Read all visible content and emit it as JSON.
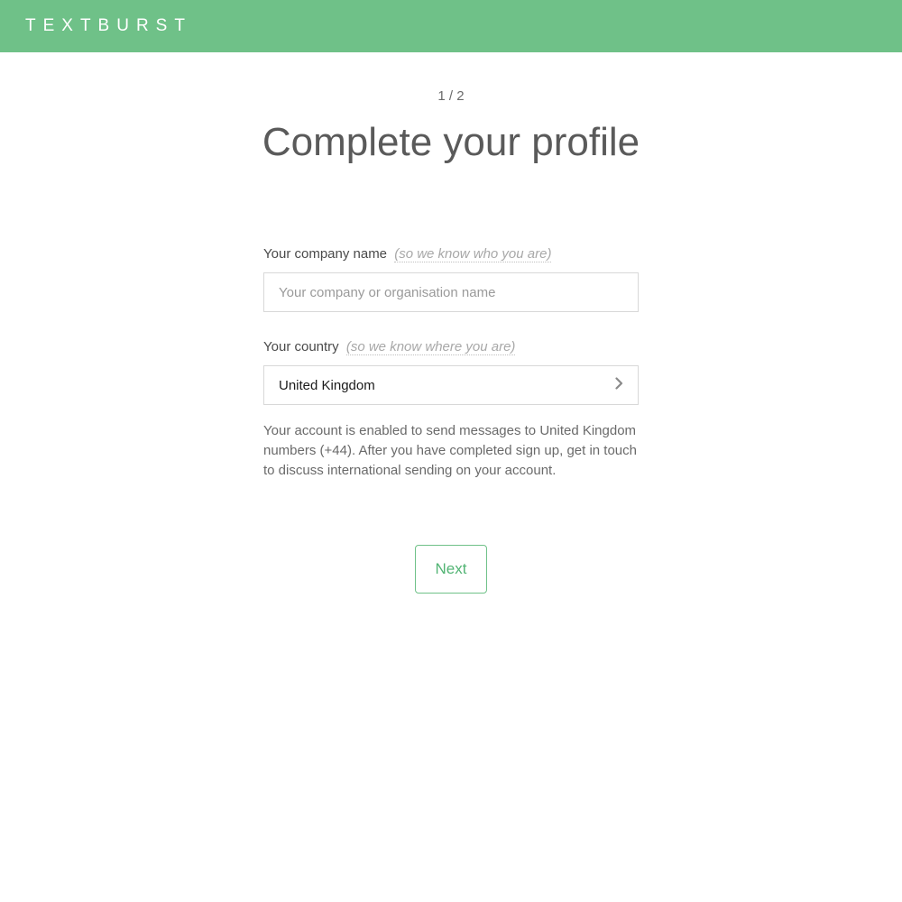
{
  "header": {
    "logo": "TEXTBURST"
  },
  "progress": "1 / 2",
  "title": "Complete your profile",
  "form": {
    "company": {
      "label": "Your company name",
      "hint": "(so we know who you are)",
      "placeholder": "Your company or organisation name",
      "value": ""
    },
    "country": {
      "label": "Your country",
      "hint": "(so we know where you are)",
      "value": "United Kingdom",
      "helper": "Your account is enabled to send messages to United Kingdom numbers (+44). After you have completed sign up, get in touch to discuss international sending on your account."
    }
  },
  "actions": {
    "next": "Next"
  }
}
